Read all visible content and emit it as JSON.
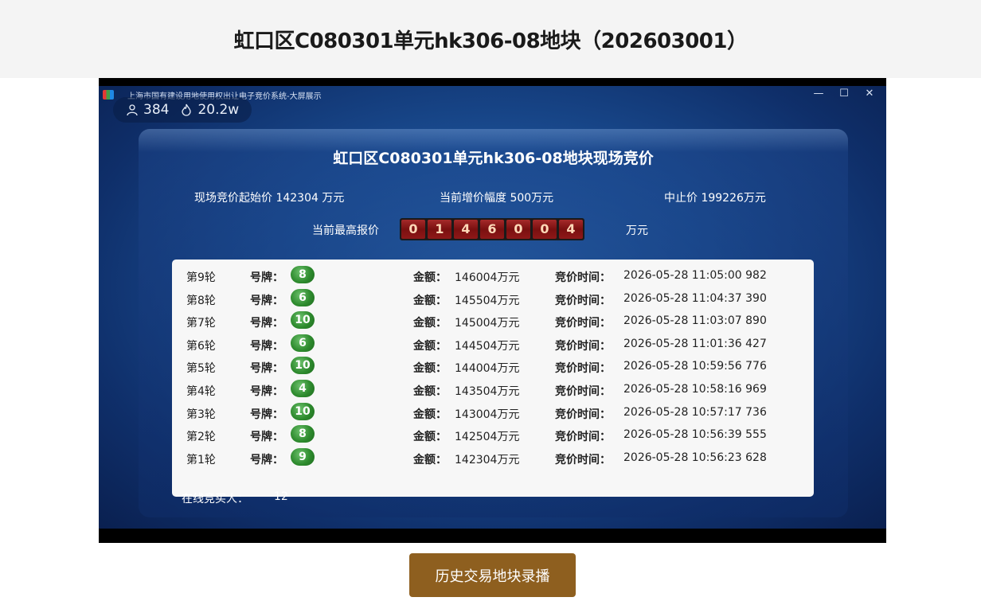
{
  "page": {
    "title": "虹口区C080301单元hk306-08地块（202603001）",
    "history_button": "历史交易地块录播"
  },
  "video": {
    "window_title": "上海市国有建设用地使用权出让电子竞价系统-大屏展示",
    "controls": [
      "—",
      "☐",
      "✕"
    ],
    "viewers": "384",
    "heat": "20.2w",
    "panel_title": "虹口区C080301单元hk306-08地块现场竞价",
    "start_price": "现场竞价起始价 142304 万元",
    "increment": "当前增价幅度 500万元",
    "stop_price": "中止价 199226万元",
    "current_bid_label": "当前最高报价",
    "current_bid_digits": [
      "0",
      "1",
      "4",
      "6",
      "0",
      "0",
      "4"
    ],
    "current_bid_unit": "万元",
    "plate_label": "号牌：",
    "amount_label": "金额：",
    "time_label": "竞价时间：",
    "bids": [
      {
        "round": "第9轮",
        "plate": "8",
        "amount": "146004万元",
        "time": "2026-05-28 11:05:00 982"
      },
      {
        "round": "第8轮",
        "plate": "6",
        "amount": "145504万元",
        "time": "2026-05-28 11:04:37 390"
      },
      {
        "round": "第7轮",
        "plate": "10",
        "amount": "145004万元",
        "time": "2026-05-28 11:03:07 890"
      },
      {
        "round": "第6轮",
        "plate": "6",
        "amount": "144504万元",
        "time": "2026-05-28 11:01:36 427"
      },
      {
        "round": "第5轮",
        "plate": "10",
        "amount": "144004万元",
        "time": "2026-05-28 10:59:56 776"
      },
      {
        "round": "第4轮",
        "plate": "4",
        "amount": "143504万元",
        "time": "2026-05-28 10:58:16 969"
      },
      {
        "round": "第3轮",
        "plate": "10",
        "amount": "143004万元",
        "time": "2026-05-28 10:57:17 736"
      },
      {
        "round": "第2轮",
        "plate": "8",
        "amount": "142504万元",
        "time": "2026-05-28 10:56:39 555"
      },
      {
        "round": "第1轮",
        "plate": "9",
        "amount": "142304万元",
        "time": "2026-05-28 10:56:23 628"
      }
    ],
    "online_label": "在线竞买人：",
    "online_count": "12"
  },
  "colors": {
    "header_bg": "#f4f4f4",
    "button_bg": "#8e5f1f",
    "plate_green": "#2e8b2e",
    "digit_red": "#8e1818"
  },
  "icons": {
    "viewers": "person-icon",
    "heat": "flame-icon"
  }
}
